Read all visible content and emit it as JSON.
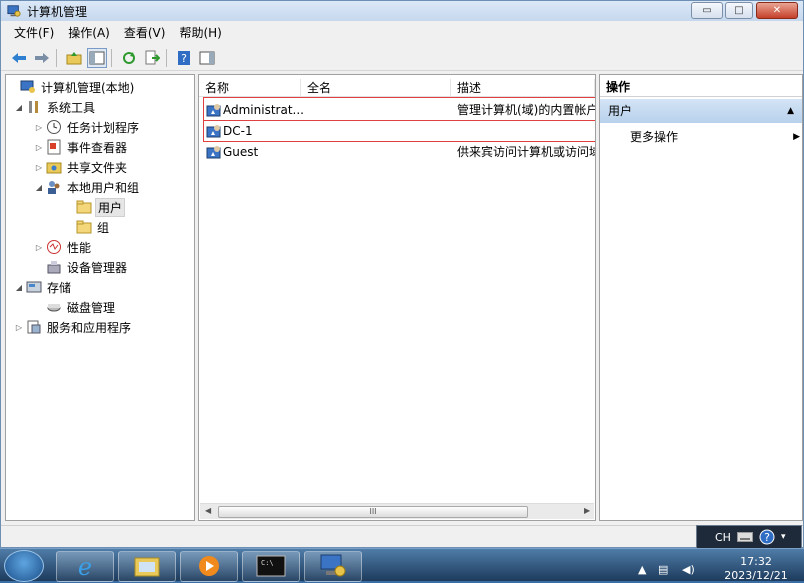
{
  "window": {
    "title": "计算机管理",
    "buttons": {
      "minimize": "▭",
      "maximize": "□",
      "close": "✕"
    }
  },
  "menu": [
    "文件(F)",
    "操作(A)",
    "查看(V)",
    "帮助(H)"
  ],
  "tree": [
    {
      "label": "计算机管理(本地)",
      "level": 0,
      "expander": "",
      "icon": "computer-management-icon"
    },
    {
      "label": "系统工具",
      "level": 1,
      "expander": "◢",
      "icon": "tools-icon"
    },
    {
      "label": "任务计划程序",
      "level": 2,
      "expander": "▷",
      "icon": "clock-icon"
    },
    {
      "label": "事件查看器",
      "level": 2,
      "expander": "▷",
      "icon": "event-viewer-icon"
    },
    {
      "label": "共享文件夹",
      "level": 2,
      "expander": "▷",
      "icon": "shared-folder-icon"
    },
    {
      "label": "本地用户和组",
      "level": 2,
      "expander": "◢",
      "icon": "users-groups-icon"
    },
    {
      "label": "用户",
      "level": 3,
      "expander": "",
      "icon": "folder-icon",
      "selected": true
    },
    {
      "label": "组",
      "level": 3,
      "expander": "",
      "icon": "folder-icon"
    },
    {
      "label": "性能",
      "level": 2,
      "expander": "▷",
      "icon": "performance-icon"
    },
    {
      "label": "设备管理器",
      "level": 2,
      "expander": "",
      "icon": "device-manager-icon"
    },
    {
      "label": "存储",
      "level": 1,
      "expander": "◢",
      "icon": "storage-icon"
    },
    {
      "label": "磁盘管理",
      "level": 2,
      "expander": "",
      "icon": "disk-icon"
    },
    {
      "label": "服务和应用程序",
      "level": 1,
      "expander": "▷",
      "icon": "services-icon"
    }
  ],
  "list": {
    "columns": [
      "名称",
      "全名",
      "描述"
    ],
    "rows": [
      {
        "name": "Administrat...",
        "fullname": "",
        "desc": "管理计算机(域)的内置帐户",
        "icon": "user-icon"
      },
      {
        "name": "DC-1",
        "fullname": "",
        "desc": "",
        "icon": "user-icon"
      },
      {
        "name": "Guest",
        "fullname": "",
        "desc": "供来宾访问计算机或访问域",
        "icon": "user-icon"
      }
    ],
    "scroll_grip": "III"
  },
  "actions": {
    "title": "操作",
    "section": "用户",
    "more": "更多操作"
  },
  "language_bar": {
    "lang": "CH"
  },
  "taskbar": {
    "time": "17:32",
    "date": "2023/12/21"
  },
  "colors": {
    "titlebar": "#c6d8ee",
    "selection_box": "#e04040",
    "taskbar": "#1d3b5c"
  }
}
